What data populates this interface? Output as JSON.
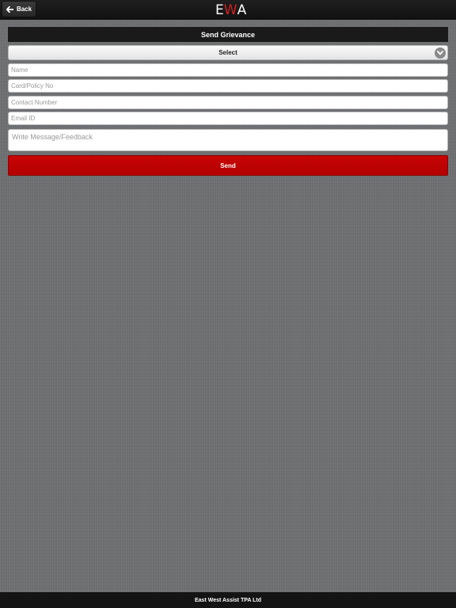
{
  "header": {
    "back_label": "Back",
    "logo_left": "E",
    "logo_mid": "W",
    "logo_right": "A"
  },
  "form": {
    "title": "Send Grievance",
    "select_value": "Select",
    "name_placeholder": "Name",
    "card_placeholder": "Card/Policy No",
    "contact_placeholder": "Contact Number",
    "email_placeholder": "Email ID",
    "message_placeholder": "Write Message/Feedback",
    "send_label": "Send"
  },
  "footer": {
    "text": "East West Assist TPA Ltd"
  },
  "colors": {
    "accent_red": "#c80404",
    "bar_dark": "#1a1a1a",
    "background": "#6e6f71"
  },
  "icons": {
    "back": "arrow-left-icon",
    "select": "chevron-down-icon"
  }
}
